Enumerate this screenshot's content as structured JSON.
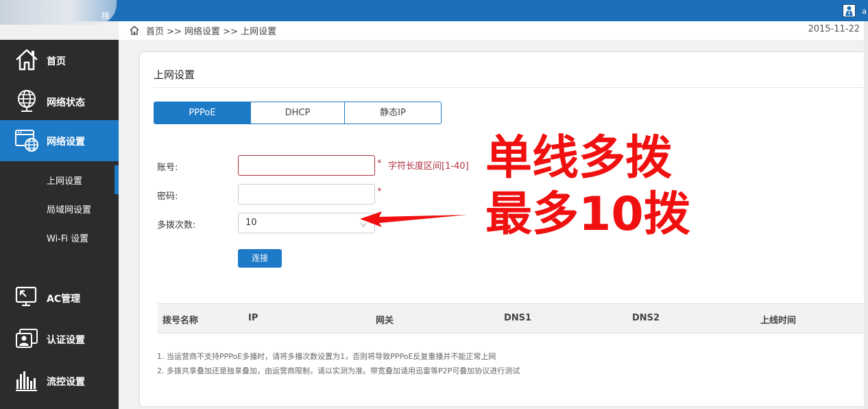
{
  "topbar": {
    "blurred_text": "接",
    "user_text": "a"
  },
  "sidebar": {
    "items": [
      {
        "label": "首页",
        "icon": "home-icon"
      },
      {
        "label": "网络状态",
        "icon": "globe-icon"
      },
      {
        "label": "网络设置",
        "icon": "network-settings-icon",
        "active": true
      },
      {
        "label": "AC管理",
        "icon": "ac-monitor-icon"
      },
      {
        "label": "认证设置",
        "icon": "auth-id-icon"
      },
      {
        "label": "流控设置",
        "icon": "flow-bars-icon"
      }
    ],
    "subitems": [
      {
        "label": "上网设置",
        "active": true
      },
      {
        "label": "局域网设置"
      },
      {
        "label": "Wi-Fi 设置"
      }
    ]
  },
  "breadcrumb": {
    "text": "首页 >> 网络设置 >> 上网设置",
    "date": "2015-11-22"
  },
  "panel": {
    "title": "上网设置"
  },
  "tabs": [
    {
      "label": "PPPoE",
      "active": true
    },
    {
      "label": "DHCP"
    },
    {
      "label": "静态IP"
    }
  ],
  "form": {
    "account_label": "账号:",
    "account_value": "",
    "account_hint": "字符长度区间[1-40]",
    "required_mark": "*",
    "password_label": "密码:",
    "password_value": "",
    "dial_count_label": "多拨次数:",
    "dial_count_value": "10",
    "connect_label": "连接"
  },
  "table": {
    "columns": [
      "拨号名称",
      "IP",
      "网关",
      "DNS1",
      "DNS2",
      "上线时间"
    ]
  },
  "notes": [
    "1. 当运营商不支持PPPoE多播时，请将多播次数设置为1，否则将导致PPPoE反复重播并不能正常上网",
    "2. 多拨共享叠加还是独享叠加，由运营商限制，请以实测为准。带宽叠加请用迅雷等P2P可叠加协议进行测试"
  ],
  "annotation": {
    "line1": "单线多拨",
    "line2": "最多10拨",
    "color": "#f01010"
  },
  "colors": {
    "accent": "#1d7ac7",
    "topbar": "#1d6fb8",
    "sidebar": "#2c2c2c",
    "error": "#b03040"
  }
}
